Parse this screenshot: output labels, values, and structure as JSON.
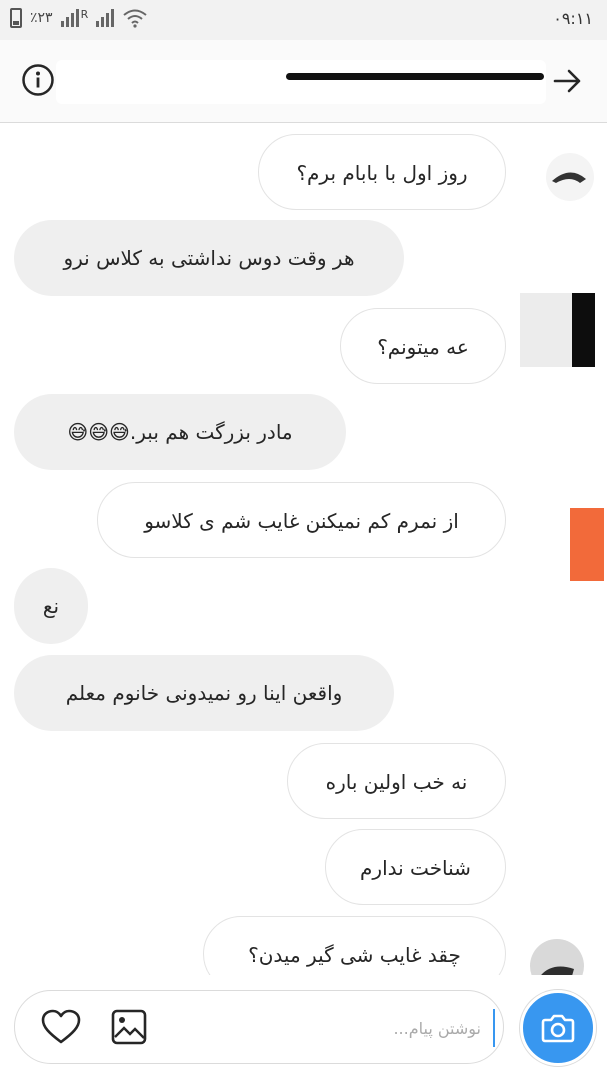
{
  "status_bar": {
    "battery": "٪۲۳",
    "carrier_mark": "R",
    "time": "۰۹:۱۱"
  },
  "header": {
    "info_icon": "info-icon",
    "back_icon": "arrow-right-icon"
  },
  "messages": [
    {
      "direction": "outgoing",
      "text": "روز اول با بابام برم؟"
    },
    {
      "direction": "incoming",
      "text": "هر وقت دوس نداشتی به کلاس نرو"
    },
    {
      "direction": "outgoing",
      "text": "عه میتونم؟"
    },
    {
      "direction": "incoming",
      "text": "مادر بزرگت هم ببر.😅😅😅"
    },
    {
      "direction": "outgoing",
      "text": "از نمرم کم نمیکنن غایب شم ی کلاسو"
    },
    {
      "direction": "incoming",
      "text": "نع"
    },
    {
      "direction": "incoming",
      "text": "واقعن اینا رو نمیدونی خانوم معلم"
    },
    {
      "direction": "outgoing",
      "text": "نه خب اولین باره"
    },
    {
      "direction": "outgoing",
      "text": "شناخت ندارم"
    },
    {
      "direction": "outgoing",
      "text": "چقد غایب شی گیر میدن؟"
    }
  ],
  "composer": {
    "placeholder": "نوشتن پیام...",
    "heart_icon": "heart-icon",
    "gallery_icon": "image-icon",
    "camera_icon": "camera-icon"
  },
  "colors": {
    "accent": "#3897f0",
    "incoming_bubble": "#efefef",
    "outgoing_border": "#e3e3e3",
    "status_bar": "#f2f2f2"
  }
}
